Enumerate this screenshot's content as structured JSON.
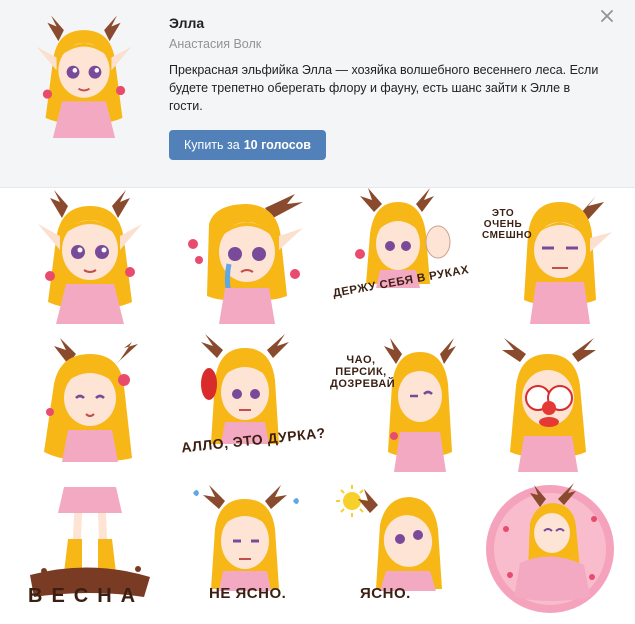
{
  "pack": {
    "title": "Элла",
    "author": "Анастасия Волк",
    "description": "Прекрасная эльфийка Элла — хозяйка волшебного весеннего леса. Если будете трепетно оберегать флору и фауну, есть шанс зайти к Элле в гости.",
    "buy_prefix": "Купить за",
    "buy_amount": "10 голосов"
  },
  "icons": {
    "close": "close-icon"
  },
  "colors": {
    "accent": "#5181b8",
    "hair": "#f7b716",
    "horn": "#8a4a2e",
    "dress": "#f3a9c2",
    "header_bg": "#f4f5f7"
  },
  "stickers": [
    {
      "caption": ""
    },
    {
      "caption": ""
    },
    {
      "caption": "ДЕРЖУ СЕБЯ В РУКАХ"
    },
    {
      "caption": "ЭТО ОЧЕНЬ СМЕШНО"
    },
    {
      "caption": ""
    },
    {
      "caption": "АЛЛО, ЭТО ДУРКА?"
    },
    {
      "caption": "ЧАО, ПЕРСИК, ДОЗРЕВАЙ"
    },
    {
      "caption": ""
    },
    {
      "caption": "ВЕСНА"
    },
    {
      "caption": "НЕ ЯСНО."
    },
    {
      "caption": "ЯСНО."
    },
    {
      "caption": ""
    }
  ]
}
